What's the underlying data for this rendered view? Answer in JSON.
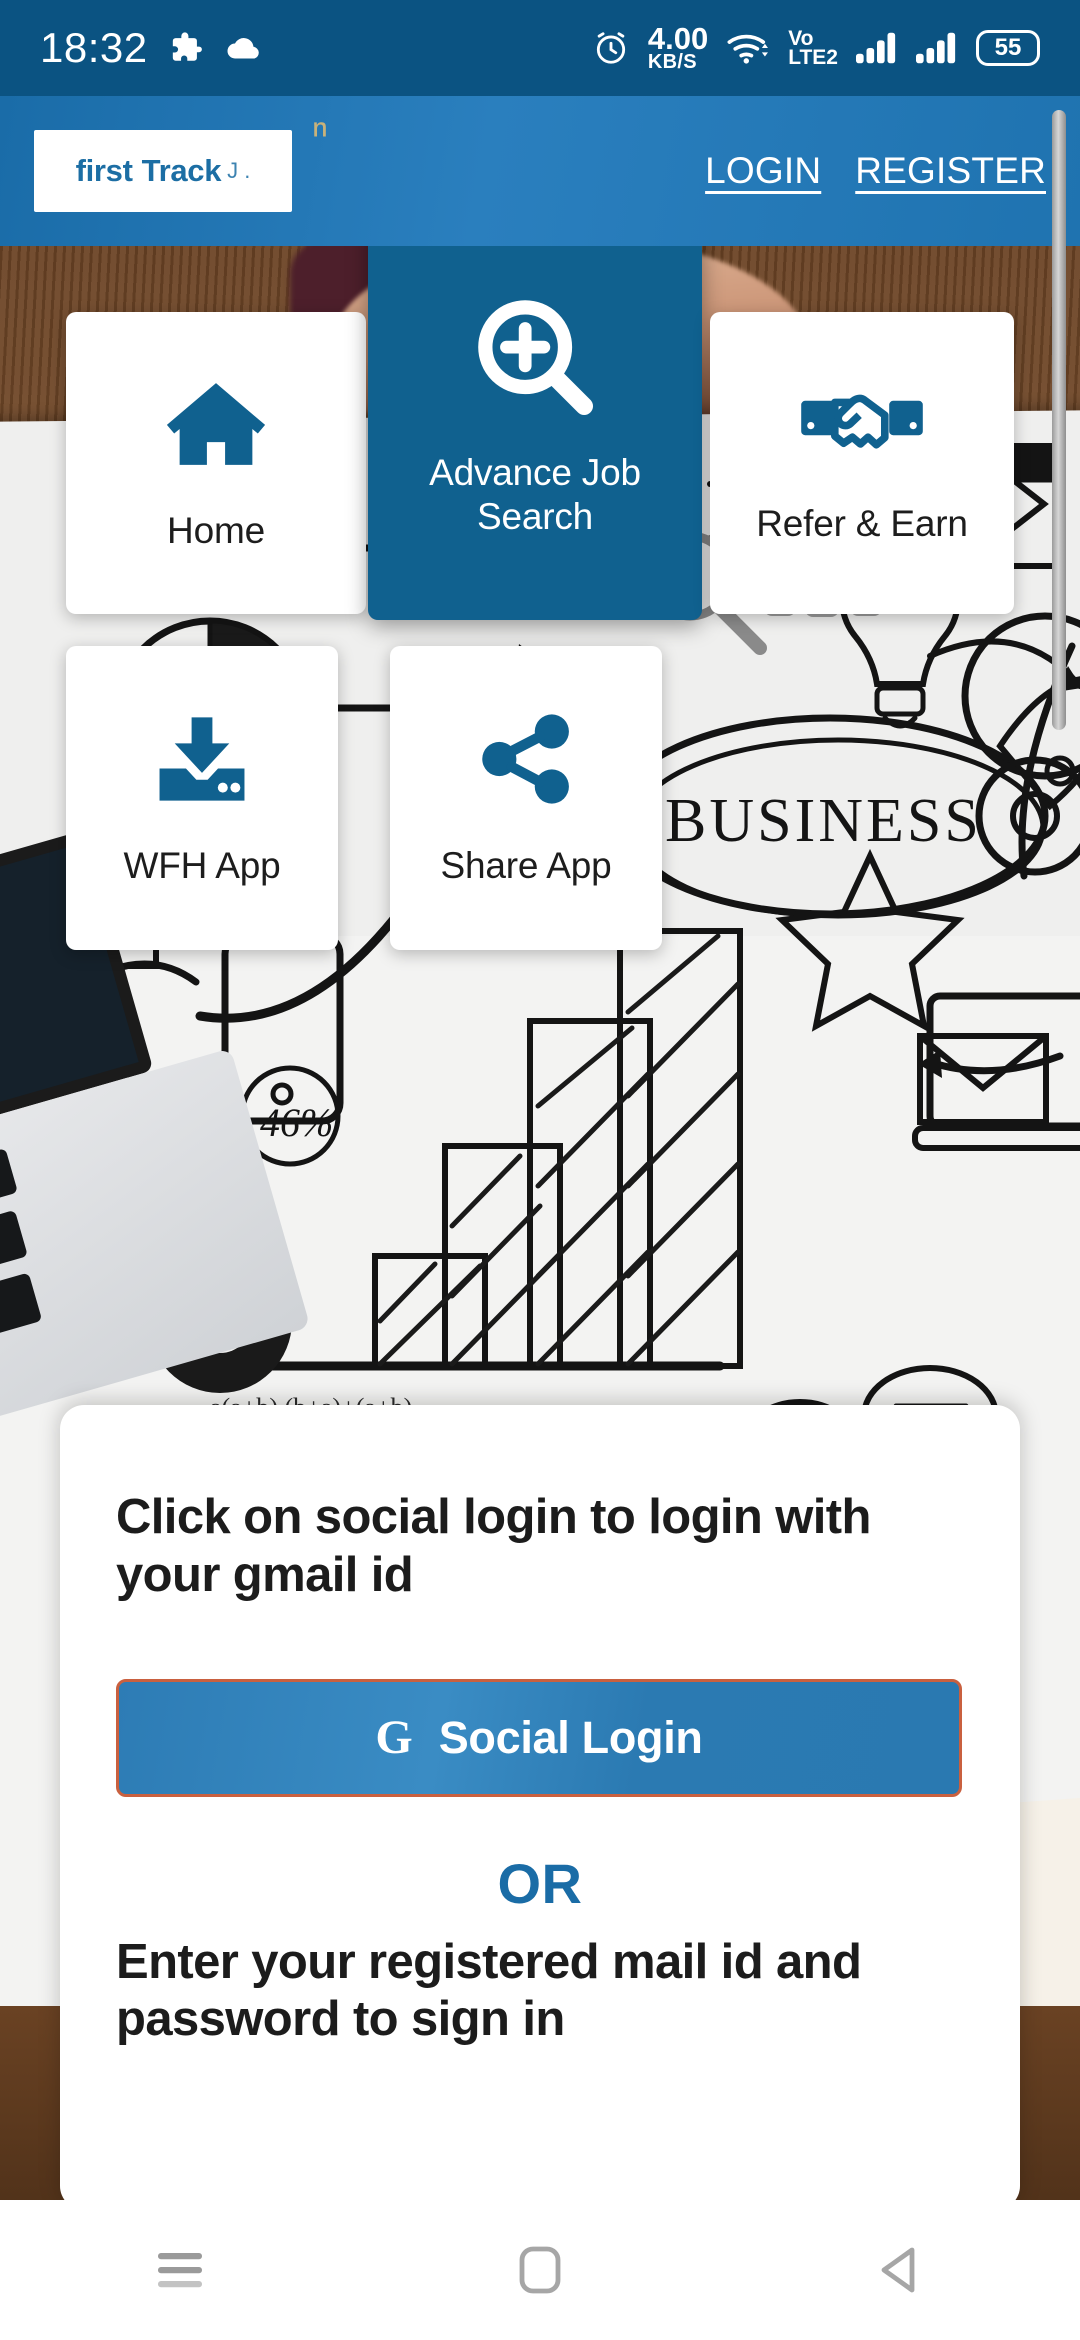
{
  "status_bar": {
    "clock": "18:32",
    "puzzle_icon": "puzzle-icon",
    "cloud_icon": "cloud-icon",
    "alarm_icon": "alarm-icon",
    "net_speed_value": "4.00",
    "net_speed_unit": "KB/S",
    "wifi_icon": "wifi-icon",
    "volte_line1": "Vo",
    "volte_line2": "LTE2",
    "signal_icon_1": "signal-bars-icon",
    "signal_icon_2": "signal-bars-icon",
    "battery_level": "55"
  },
  "app_bar": {
    "logo_part1": "first",
    "logo_part2": "Track",
    "logo_tail": "J .",
    "login_label": "LOGIN",
    "register_label": "REGISTER"
  },
  "tiles": [
    {
      "id": "home",
      "label": "Home",
      "icon": "house-icon",
      "active": false
    },
    {
      "id": "search",
      "label": "Advance Job Search",
      "icon": "magnifier-plus-icon",
      "active": true
    },
    {
      "id": "refer",
      "label": "Refer & Earn",
      "icon": "handshake-icon",
      "active": false
    },
    {
      "id": "wfh",
      "label": "WFH App",
      "icon": "download-tray-icon",
      "active": false
    },
    {
      "id": "share",
      "label": "Share App",
      "icon": "share-nodes-icon",
      "active": false
    }
  ],
  "login_card": {
    "title": "Click on social login to login with your gmail id",
    "social_button_glyph": "G",
    "social_button_label": "Social Login",
    "divider_label": "OR",
    "subtitle": "Enter your registered mail id and password to sign in"
  },
  "nav_bar": {
    "recents_icon": "menu-lines-icon",
    "home_icon": "square-home-icon",
    "back_icon": "back-triangle-icon"
  },
  "colors": {
    "status_bar_bg": "#0b5382",
    "app_bar_bg": "#2a7fbe",
    "brand_blue": "#10618f",
    "accent_orange": "#c9603f",
    "tile_bg": "#ffffff",
    "card_bg": "#ffffff"
  }
}
